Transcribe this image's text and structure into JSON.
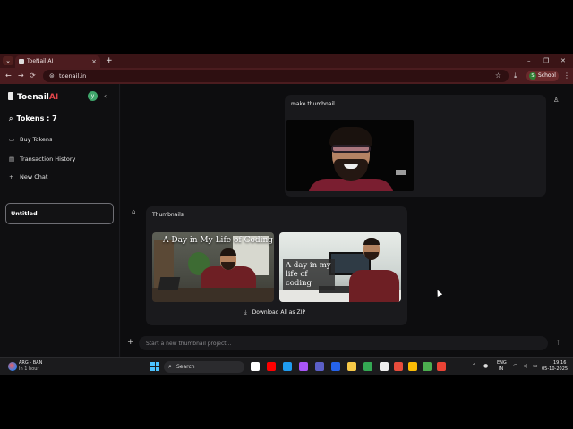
{
  "browser": {
    "tab_title": "ToeNail AI",
    "tab_close": "×",
    "new_tab": "+",
    "url": "toenail.in",
    "profile_initial": "S",
    "profile_label": "School",
    "minimize": "–",
    "maximize": "❐",
    "close": "✕",
    "back": "←",
    "forward": "→",
    "reload": "⟳",
    "bookmark": "☆",
    "download": "⤓",
    "menu": "⋮",
    "tab_menu": "⌄"
  },
  "sidebar": {
    "logo_main": "Toenail",
    "logo_accent": "AI",
    "avatar_initial": "y",
    "collapse": "‹",
    "tokens_label": "Tokens : 7",
    "items": [
      {
        "label": "Buy Tokens",
        "icon": "▭"
      },
      {
        "label": "Transaction History",
        "icon": "▤"
      },
      {
        "label": "New Chat",
        "icon": "+"
      }
    ],
    "chats": [
      {
        "label": "Untitled"
      }
    ]
  },
  "chat": {
    "user_message": "make thumbnail",
    "bot_message": "Thumbnails",
    "thumbnails": [
      {
        "overlay_text": "A Day in My Life of Coding"
      },
      {
        "overlay_text": "A day in my life of coding"
      }
    ],
    "download_label": "Download All as ZIP",
    "composer_placeholder": "Start a new thumbnail project...",
    "add_icon": "+",
    "send_icon": "↑",
    "user_icon": "♙",
    "bot_icon": "⌂"
  },
  "taskbar": {
    "weather_title": "ARG - BAN",
    "weather_sub": "In 1 hour",
    "search_label": "Search",
    "lang_line1": "ENG",
    "lang_line2": "IN",
    "time": "19:16",
    "date": "05-10-2025",
    "apps": [
      {
        "name": "task-view",
        "color": "#ffffff"
      },
      {
        "name": "youtube",
        "color": "#ff0000"
      },
      {
        "name": "edge",
        "color": "#1f9cf0"
      },
      {
        "name": "copilot",
        "color": "#a855f7"
      },
      {
        "name": "teams",
        "color": "#5b5fc7"
      },
      {
        "name": "mail",
        "color": "#2563eb"
      },
      {
        "name": "file-explorer",
        "color": "#f7c948"
      },
      {
        "name": "chrome-1",
        "color": "#34a853"
      },
      {
        "name": "notes",
        "color": "#eeeeee"
      },
      {
        "name": "app-red",
        "color": "#e74c3c"
      },
      {
        "name": "chrome-2",
        "color": "#fbbc05"
      },
      {
        "name": "chrome-3",
        "color": "#4caf50"
      },
      {
        "name": "chrome-4",
        "color": "#ea4335"
      }
    ]
  },
  "colors": {
    "accent": "#e0454a",
    "tab_bar": "#3a1416",
    "toolbar": "#4b1c1f",
    "app_bg": "#0e0e10"
  }
}
